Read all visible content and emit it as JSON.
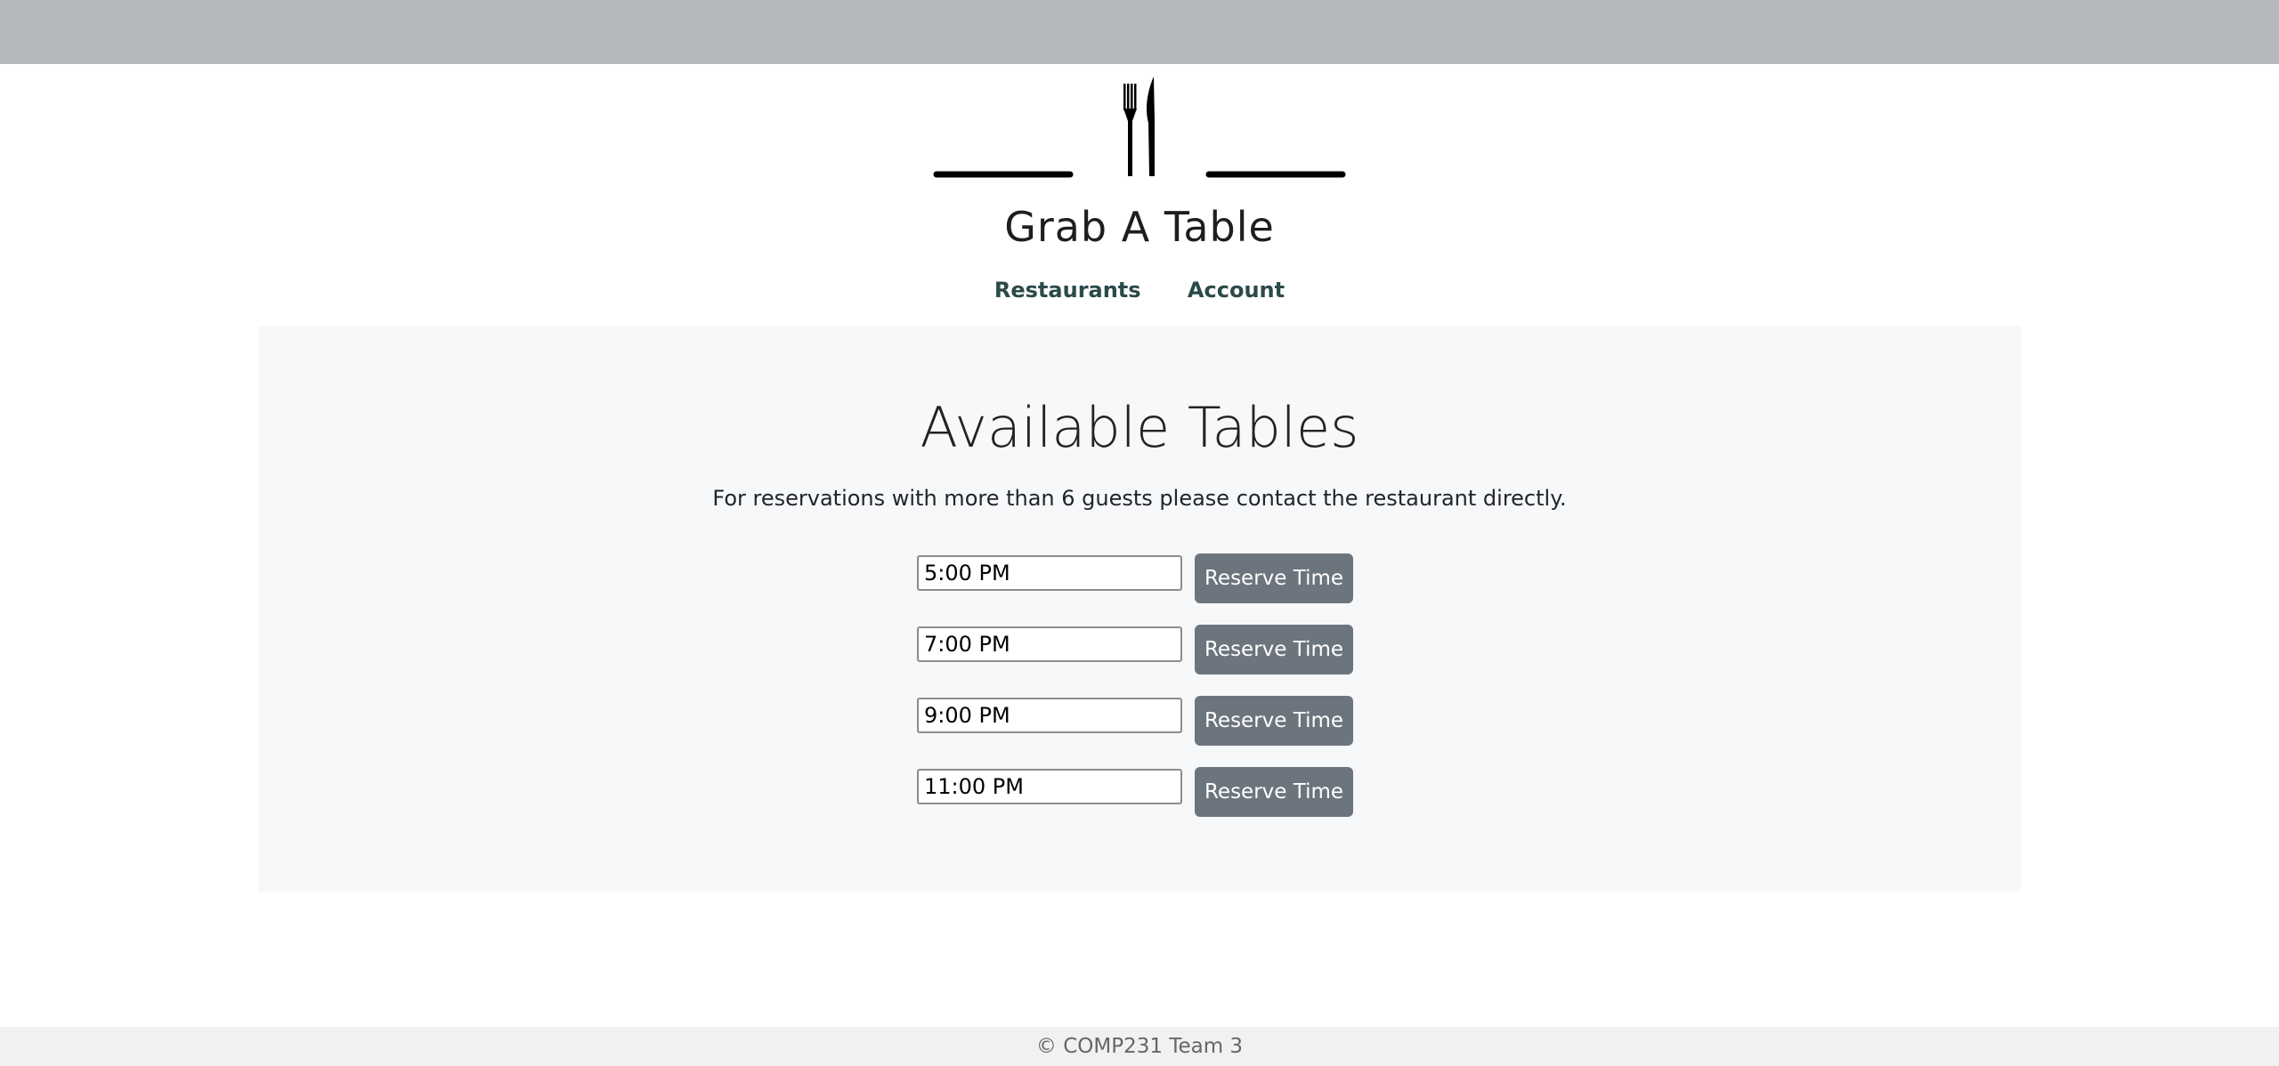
{
  "brand": {
    "name": "Grab A Table",
    "logo_icon": "fork-knife-icon"
  },
  "nav": {
    "items": [
      {
        "label": "Restaurants"
      },
      {
        "label": "Account"
      }
    ]
  },
  "main": {
    "title": "Available Tables",
    "note": "For reservations with more than 6 guests please contact the restaurant directly.",
    "slots": [
      {
        "time": "5:00 PM",
        "button": "Reserve Time"
      },
      {
        "time": "7:00 PM",
        "button": "Reserve Time"
      },
      {
        "time": "9:00 PM",
        "button": "Reserve Time"
      },
      {
        "time": "11:00 PM",
        "button": "Reserve Time"
      }
    ]
  },
  "footer": {
    "text": "© COMP231 Team 3"
  },
  "colors": {
    "topbar": "#b5b8bd",
    "button": "#6c757d",
    "nav_link": "#2b4a4a",
    "panel": "#f7f8f9"
  }
}
